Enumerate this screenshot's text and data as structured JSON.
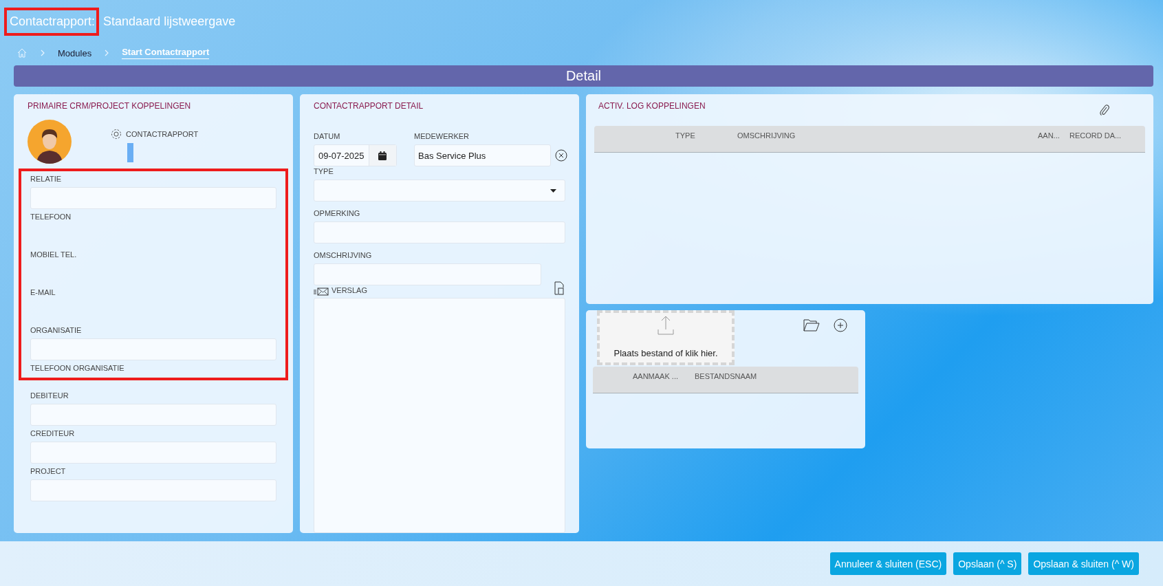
{
  "title": {
    "segments": [
      {
        "text": "Contactrapport:",
        "highlighted": true
      },
      {
        "text": "Standaard lijstweergave",
        "highlighted": false
      }
    ]
  },
  "breadcrumb": [
    {
      "label": "Modules",
      "selected": false
    },
    {
      "label": "Start Contactrapport",
      "selected": true
    }
  ],
  "section_header": "Detail",
  "left_panel": {
    "title": "PRIMAIRE CRM/PROJECT KOPPELINGEN",
    "link_label": "CONTACTRAPPORT",
    "groups": [
      {
        "highlighted": true,
        "fields": [
          {
            "label": "RELATIE",
            "kind": "input"
          },
          {
            "label": "TELEFOON",
            "kind": "empty"
          },
          {
            "label": "MOBIEL TEL.",
            "kind": "empty"
          },
          {
            "label": "E-MAIL",
            "kind": "empty"
          },
          {
            "label": "ORGANISATIE",
            "kind": "input"
          },
          {
            "label": "TELEFOON ORGANISATIE",
            "kind": "empty"
          }
        ]
      },
      {
        "highlighted": false,
        "fields": [
          {
            "label": "DEBITEUR",
            "kind": "input"
          },
          {
            "label": "CREDITEUR",
            "kind": "input"
          },
          {
            "label": "PROJECT",
            "kind": "input"
          }
        ]
      }
    ]
  },
  "detail_panel": {
    "title": "CONTACTRAPPORT DETAIL",
    "datum": {
      "label": "DATUM",
      "value": "09-07-2025"
    },
    "medewerker": {
      "label": "MEDEWERKER",
      "value": "Bas Service Plus"
    },
    "type": {
      "label": "TYPE"
    },
    "opmerking": {
      "label": "OPMERKING"
    },
    "omschrijving": {
      "label": "OMSCHRIJVING"
    },
    "verslag": {
      "label": "VERSLAG"
    }
  },
  "log_panel": {
    "title": "ACTIV. LOG KOPPELINGEN",
    "columns": [
      "TYPE",
      "OMSCHRIJVING",
      "AAN...",
      "RECORD DA..."
    ]
  },
  "files_panel": {
    "dropzone": "Plaats bestand of klik hier.",
    "columns": [
      "AANMAAK ...",
      "BESTANDSNAAM"
    ]
  },
  "buttons": [
    "Annuleer & sluiten (ESC)",
    "Opslaan (^ S)",
    "Opslaan & sluiten (^ W)"
  ]
}
